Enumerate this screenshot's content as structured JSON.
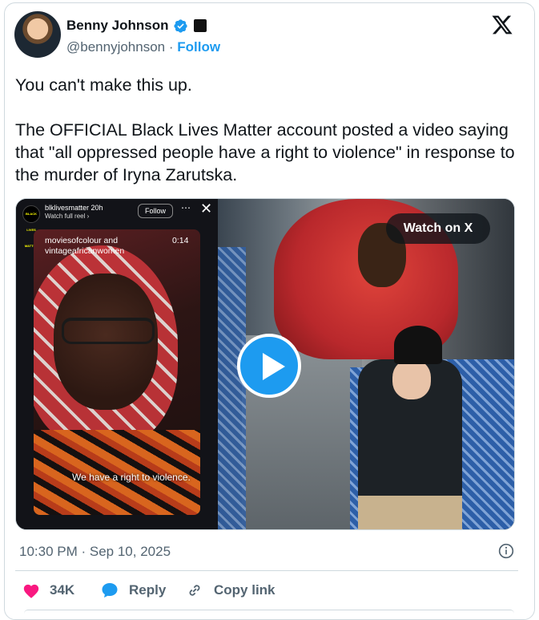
{
  "author": {
    "name": "Benny Johnson",
    "handle": "@bennyjohnson",
    "follow_label": "Follow",
    "separator": "·"
  },
  "tweet": {
    "line1": "You can't make this up.",
    "line2": "The OFFICIAL Black Lives Matter account posted a video saying that \"all oppressed people have a right to violence\" in response to the murder of Iryna Zarutska."
  },
  "media": {
    "watch_label": "Watch on X",
    "reel": {
      "logo_text": "BLACK LIVES MATTER",
      "user": "blklivesmatter",
      "time_ago": "20h",
      "watch_full_reel": "Watch full reel ›",
      "follow_label": "Follow",
      "more_icon": "⋯",
      "close_icon": "✕",
      "tag_line1": "moviesofcolour and",
      "tag_line2": "vintageafricanwomen",
      "duration": "0:14",
      "caption": "We have a right to violence."
    }
  },
  "meta": {
    "timestamp": "10:30 PM · Sep 10, 2025"
  },
  "actions": {
    "likes": "34K",
    "reply_label": "Reply",
    "copy_link_label": "Copy link"
  },
  "colors": {
    "accent": "#1d9bf0",
    "heart": "#f91880",
    "muted": "#536471"
  }
}
